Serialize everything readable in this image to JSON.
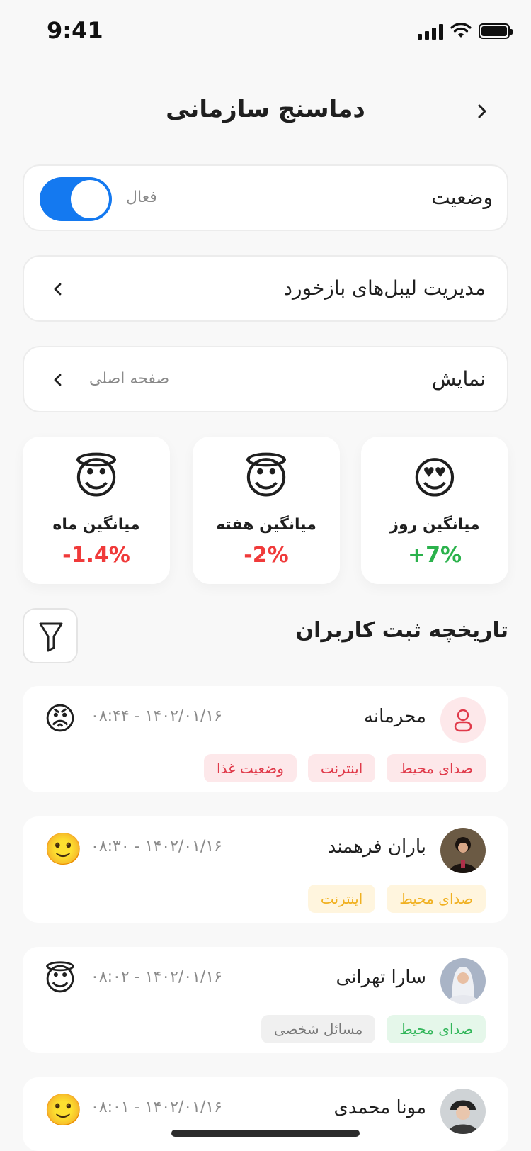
{
  "status": {
    "time": "9:41"
  },
  "header": {
    "title": "دماسنج سازمانی",
    "back_icon": "chevron-right-icon"
  },
  "status_row": {
    "label": "وضعیت",
    "state_text": "فعال",
    "enabled": true,
    "accent": "#1479f0"
  },
  "labels_row": {
    "label": "مدیریت لیبل‌های بازخورد"
  },
  "display_row": {
    "label": "نمایش",
    "value": "صفحه اصلی"
  },
  "stats": [
    {
      "label": "میانگین روز",
      "value": "+7%",
      "emoji": "😍",
      "color": "#2bb24c"
    },
    {
      "label": "میانگین هفته",
      "value": "-2%",
      "emoji": "😇",
      "color": "#f03a3a"
    },
    {
      "label": "میانگین ماه",
      "value": "-1.4%",
      "emoji": "😇",
      "color": "#f03a3a"
    }
  ],
  "history": {
    "title": "تاریخچه ثبت کاربران",
    "entries": [
      {
        "name": "محرمانه",
        "datetime": "۱۴۰۲/۰۱/۱۶ - ۰۸:۴۴",
        "mood": "😡",
        "tags": [
          "صدای محیط",
          "اینترنت",
          "وضعیت غذا"
        ],
        "tag_color": "red"
      },
      {
        "name": "باران فرهمند",
        "datetime": "۱۴۰۲/۰۱/۱۶ - ۰۸:۳۰",
        "mood": "🙂",
        "tags": [
          "صدای محیط",
          "اینترنت"
        ],
        "tag_color": "yellow"
      },
      {
        "name": "سارا تهرانی",
        "datetime": "۱۴۰۲/۰۱/۱۶ - ۰۸:۰۲",
        "mood": "😇",
        "tags": [
          "صدای محیط",
          "مسائل شخصی"
        ],
        "tag_color": "green"
      },
      {
        "name": "مونا محمدی",
        "datetime": "۱۴۰۲/۰۱/۱۶ - ۰۸:۰۱",
        "mood": "🙂"
      }
    ]
  }
}
